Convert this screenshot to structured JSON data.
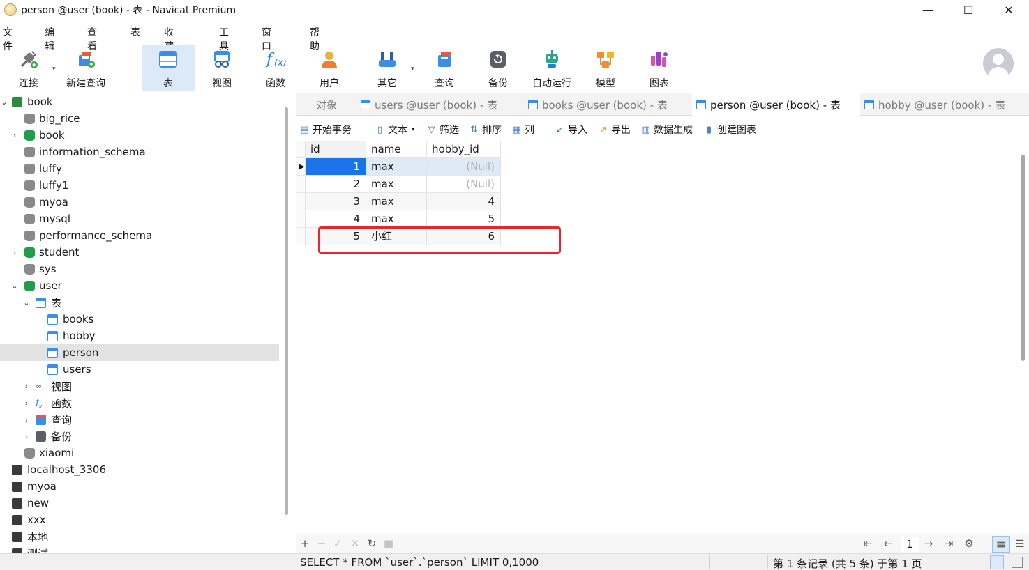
{
  "window": {
    "title": "person @user (book) - 表 - Navicat Premium",
    "controls": {
      "minimize": "—",
      "maximize": "☐",
      "close": "✕"
    }
  },
  "menu": [
    "文件",
    "编辑",
    "查看",
    "表",
    "收藏夹",
    "工具",
    "窗口",
    "帮助"
  ],
  "toolbar": {
    "connect": "连接",
    "new_query": "新建查询",
    "table": "表",
    "view": "视图",
    "function": "函数",
    "user": "用户",
    "other": "其它",
    "query": "查询",
    "backup": "备份",
    "automation": "自动运行",
    "model": "模型",
    "chart": "图表"
  },
  "sidebar": {
    "connection": "book",
    "databases": [
      "big_rice",
      "book",
      "information_schema",
      "luffy",
      "luffy1",
      "myoa",
      "mysql",
      "performance_schema",
      "student",
      "sys",
      "user"
    ],
    "tables_group": "表",
    "tables": [
      "books",
      "hobby",
      "person",
      "users"
    ],
    "views_group": "视图",
    "functions_group": "函数",
    "queries_group": "查询",
    "backups_group": "备份",
    "after_user_db": "xiaomi",
    "other_connections": [
      "localhost_3306",
      "myoa",
      "new",
      "xxx",
      "本地",
      "测试"
    ]
  },
  "tabs": {
    "objects": "对象",
    "items": [
      "users @user (book) - 表",
      "books @user (book) - 表",
      "person @user (book) - 表",
      "hobby @user (book) - 表"
    ],
    "active_index": 2
  },
  "table_toolbar": {
    "begin_transaction": "开始事务",
    "text": "文本",
    "filter": "筛选",
    "sort": "排序",
    "columns": "列",
    "import": "导入",
    "export": "导出",
    "data_generation": "数据生成",
    "create_chart": "创建图表"
  },
  "grid": {
    "columns": [
      "id",
      "name",
      "hobby_id"
    ],
    "rows": [
      [
        "1",
        "max",
        "(Null)"
      ],
      [
        "2",
        "max",
        "(Null)"
      ],
      [
        "3",
        "max",
        "4"
      ],
      [
        "4",
        "max",
        "5"
      ],
      [
        "5",
        "小红",
        "6"
      ]
    ],
    "selected_row": 0,
    "highlighted_row": 4
  },
  "footer": {
    "add": "+",
    "remove": "−",
    "apply": "✓",
    "discard": "✕",
    "refresh": "↻",
    "stop": "■",
    "first": "⇤",
    "prev": "←",
    "page": "1",
    "next": "→",
    "last": "⇥",
    "settings": "⚙",
    "grid_view": "▦",
    "form_view": "☰"
  },
  "status": {
    "sql": "SELECT * FROM `user`.`person` LIMIT 0,1000",
    "records": "第 1 条记录 (共 5 条) 于第 1 页"
  },
  "colors": {
    "accent": "#1a73e8",
    "selection_bg": "#dce9f7",
    "highlight_border": "#e8262b",
    "db_green": "#1f9e4a"
  }
}
